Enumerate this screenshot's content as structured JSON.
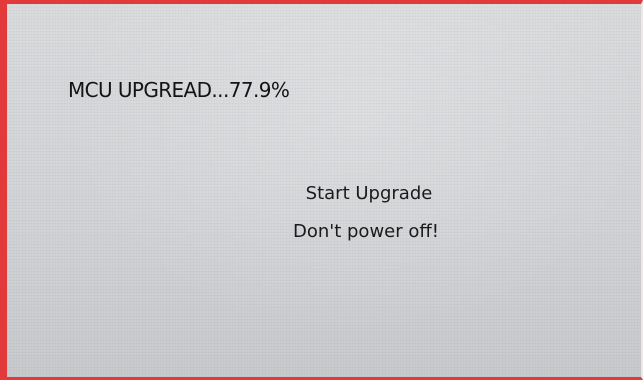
{
  "screen": {
    "mcu_status": "MCU UPGREAD...77.9%",
    "start_message": "Start Upgrade",
    "warning_message": "Don't power off!"
  },
  "progress": {
    "percent": 77.9
  },
  "colors": {
    "border": "#e23a3a",
    "screen_background": "#d8dadc",
    "text": "#141414"
  }
}
